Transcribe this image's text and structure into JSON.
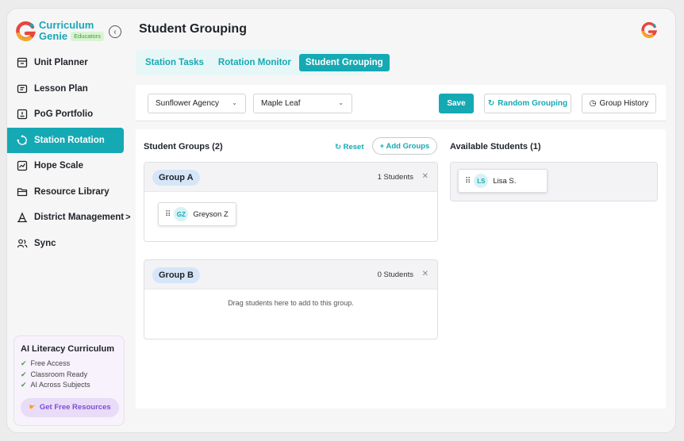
{
  "brand": {
    "name_line1": "Curriculum",
    "name_line2": "Genie",
    "badge": "Educators",
    "colors": {
      "teal": "#15a9b4",
      "orange": "#f6a623",
      "red": "#e8453c",
      "green": "#3fa34d"
    }
  },
  "sidebar": {
    "collapse_icon": "chevron-left-icon",
    "items": [
      {
        "label": "Unit Planner",
        "icon": "calendar-icon",
        "active": false
      },
      {
        "label": "Lesson Plan",
        "icon": "book-icon",
        "active": false
      },
      {
        "label": "PoG Portfolio",
        "icon": "portfolio-icon",
        "active": false
      },
      {
        "label": "Station Rotation",
        "icon": "rotation-icon",
        "active": true
      },
      {
        "label": "Hope Scale",
        "icon": "chart-icon",
        "active": false
      },
      {
        "label": "Resource Library",
        "icon": "folder-icon",
        "active": false
      },
      {
        "label": "District Management",
        "icon": "building-icon",
        "active": false,
        "chevron": ">"
      },
      {
        "label": "Sync",
        "icon": "users-icon",
        "active": false
      }
    ]
  },
  "promo": {
    "title": "AI Literacy Curriculum",
    "items": [
      "Free Access",
      "Classroom Ready",
      "AI Across Subjects"
    ],
    "cta": "Get Free Resources",
    "cta_icon": "pointing-hand-icon"
  },
  "header": {
    "title": "Student Grouping",
    "avatar_icon": "google-g-icon"
  },
  "tabs": [
    {
      "label": "Station Tasks",
      "active": false
    },
    {
      "label": "Rotation Monitor",
      "active": false
    },
    {
      "label": "Student Grouping",
      "active": true
    }
  ],
  "toolbar": {
    "agency_select": "Sunflower Agency",
    "class_select": "Maple Leaf",
    "save_label": "Save",
    "random_label": "Random Grouping",
    "history_label": "Group History"
  },
  "groups_panel": {
    "title": "Student Groups (2)",
    "reset_label": "Reset",
    "add_label": "+ Add Groups",
    "groups": [
      {
        "name": "Group A",
        "count_label": "1 Students",
        "students": [
          {
            "initials": "GZ",
            "name": "Greyson Z"
          }
        ]
      },
      {
        "name": "Group B",
        "count_label": "0 Students",
        "empty_text": "Drag students here to add to this group."
      }
    ]
  },
  "available_panel": {
    "title": "Available Students (1)",
    "students": [
      {
        "initials": "LS",
        "name": "Lisa S."
      }
    ]
  }
}
